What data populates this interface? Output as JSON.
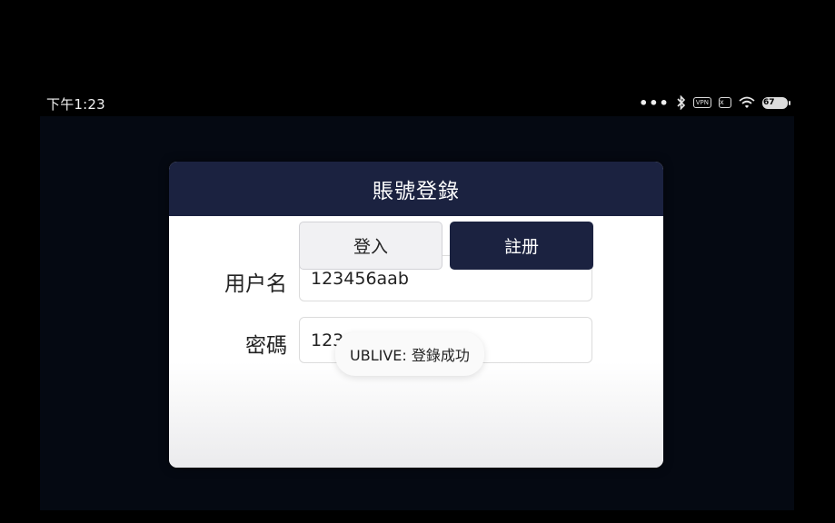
{
  "status_bar": {
    "time": "下午1:23",
    "icons": [
      "more-dots-icon",
      "bluetooth-icon",
      "vpn-icon",
      "sim-icon",
      "wifi-icon",
      "battery-icon"
    ],
    "vpn_label": "VPN",
    "sim_label": "x",
    "battery_level": "67"
  },
  "dialog": {
    "title": "賬號登錄",
    "username": {
      "label": "用户名",
      "value": "123456aab"
    },
    "password": {
      "label": "密碼",
      "value": "123"
    },
    "login_button": "登入",
    "register_button": "註册"
  },
  "toast": {
    "text": "UBLIVE: 登錄成功"
  },
  "colors": {
    "header": "#1b2240",
    "register_button": "#1b2240",
    "background": "#000000"
  }
}
